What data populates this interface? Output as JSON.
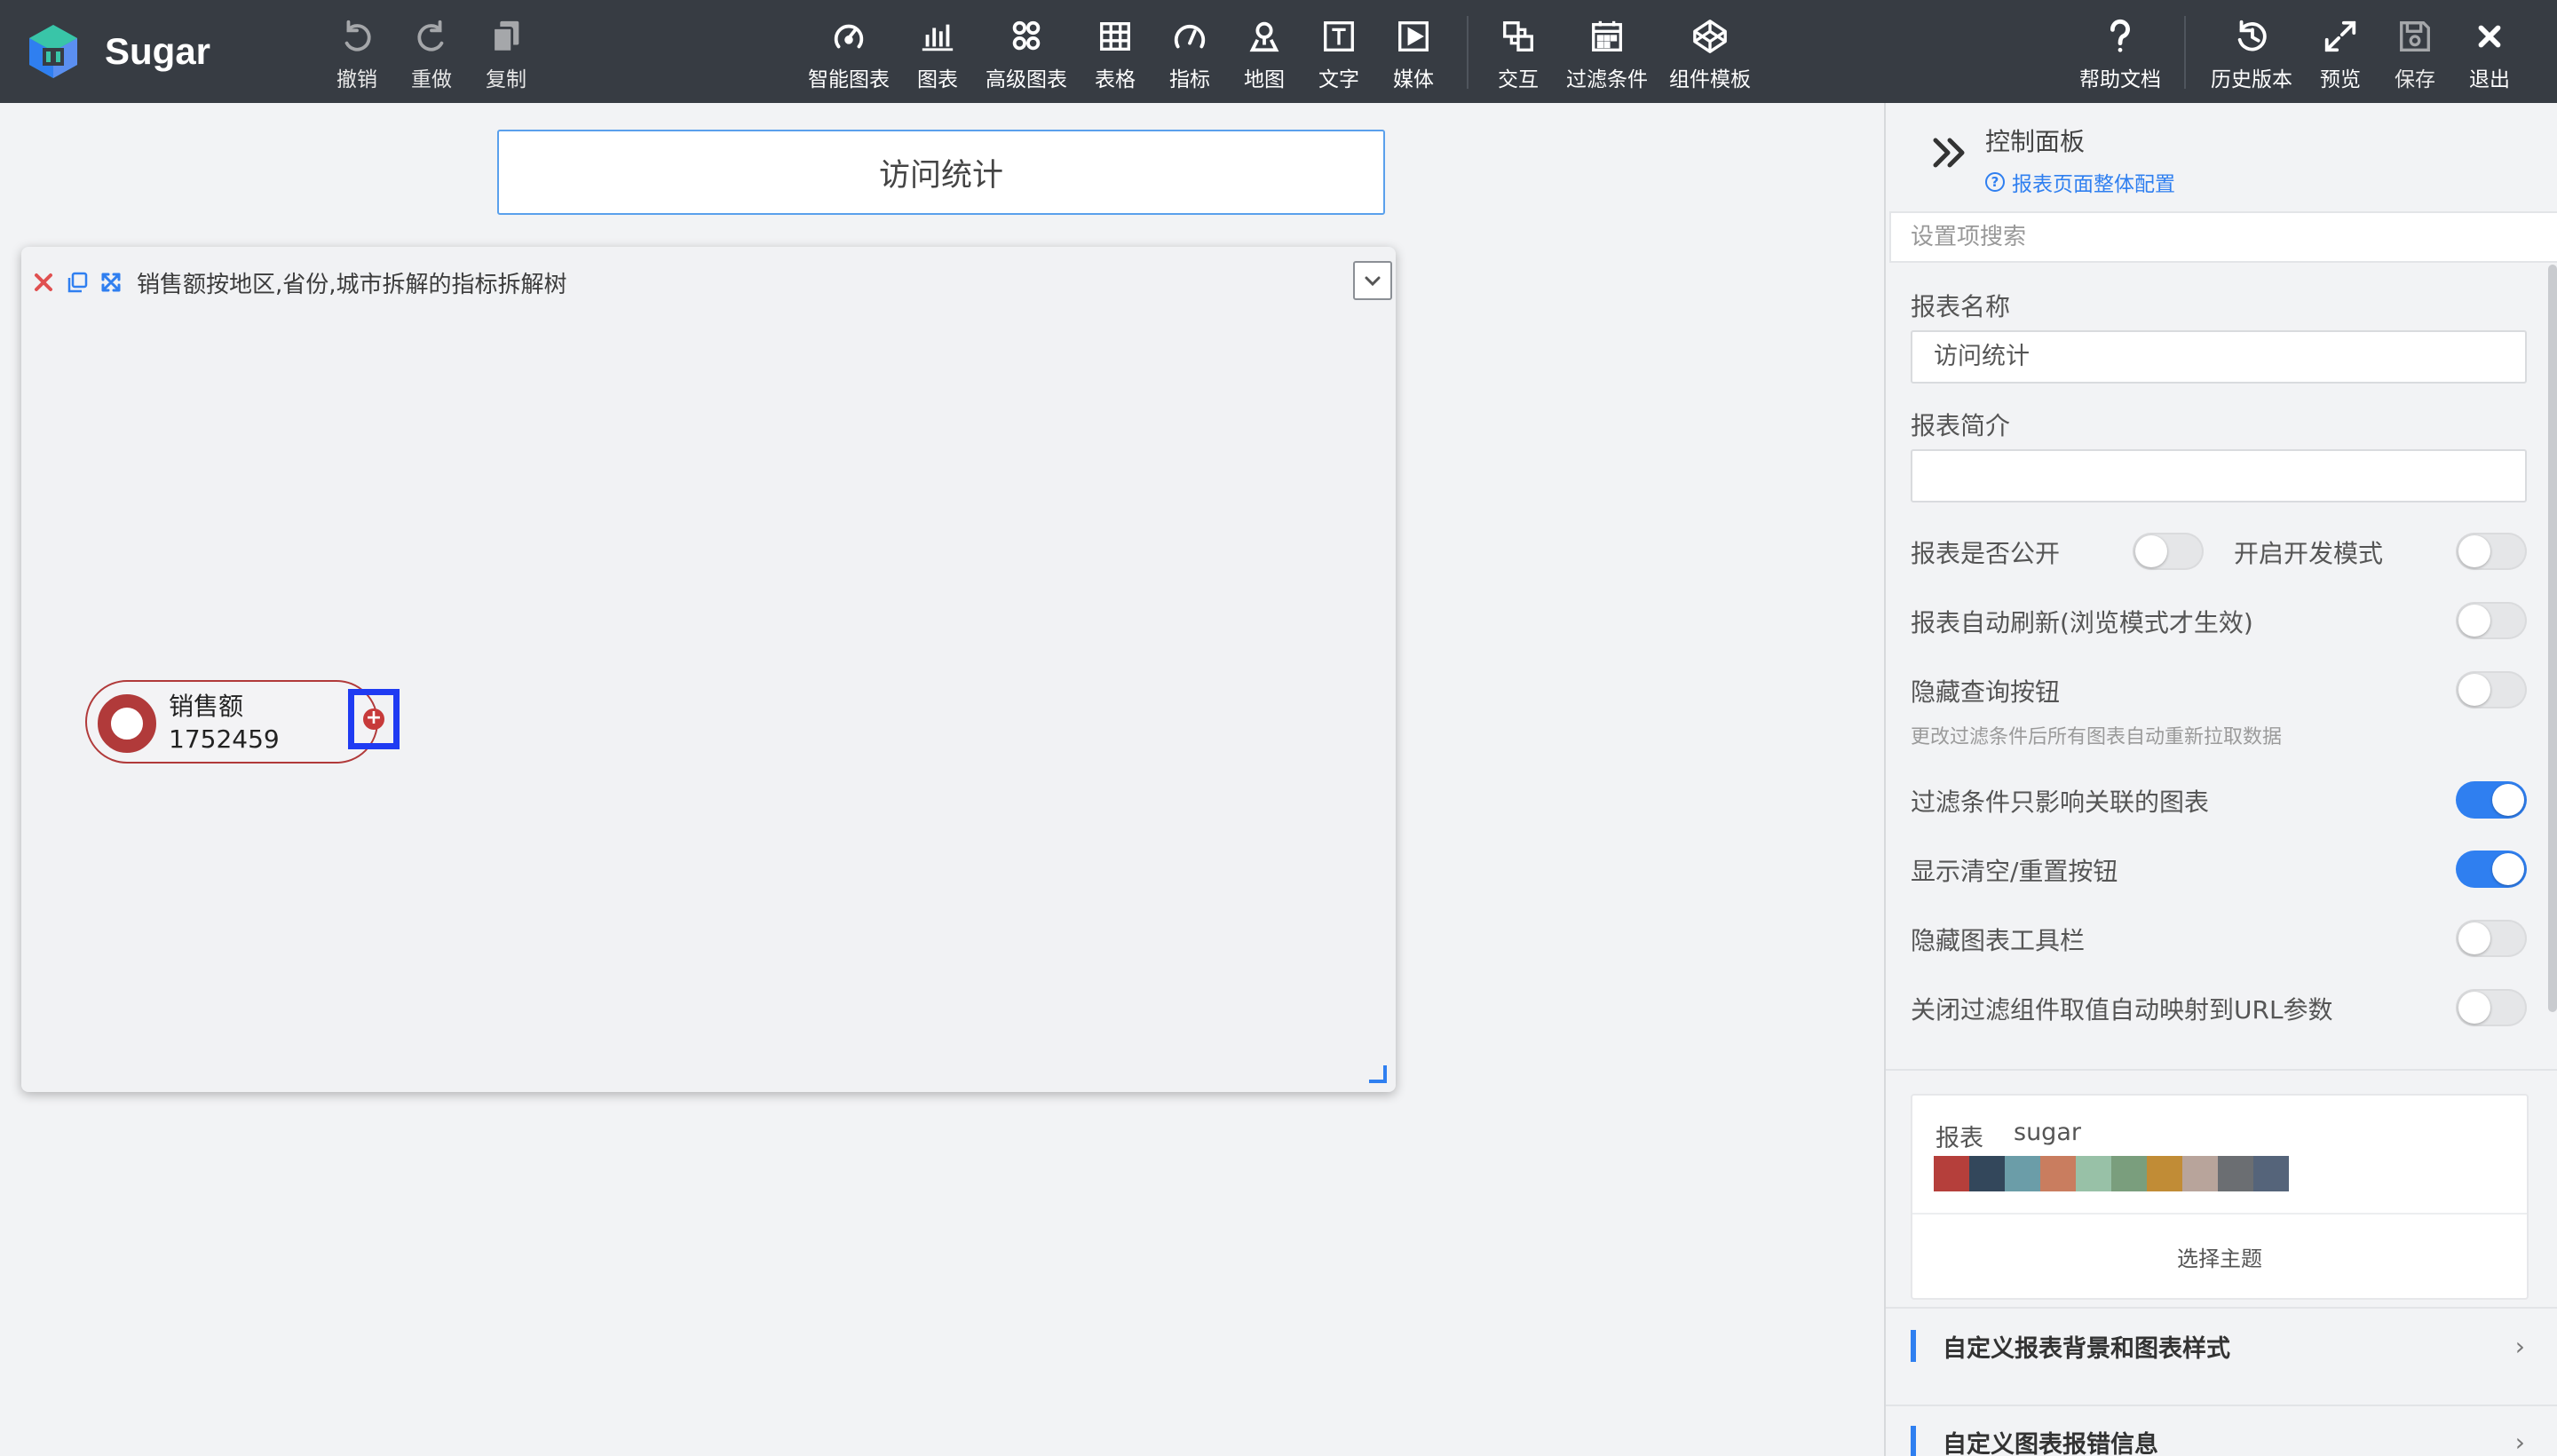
{
  "brand": {
    "name": "Sugar"
  },
  "toolbar": {
    "left": [
      {
        "id": "undo",
        "label": "撤销",
        "icon": "undo-icon"
      },
      {
        "id": "redo",
        "label": "重做",
        "icon": "redo-icon"
      },
      {
        "id": "copy",
        "label": "复制",
        "icon": "copy-icon"
      }
    ],
    "center": [
      {
        "id": "smart-chart",
        "label": "智能图表",
        "icon": "smart-chart-icon"
      },
      {
        "id": "chart",
        "label": "图表",
        "icon": "bar-chart-icon"
      },
      {
        "id": "adv-chart",
        "label": "高级图表",
        "icon": "advanced-chart-icon"
      },
      {
        "id": "table",
        "label": "表格",
        "icon": "table-icon"
      },
      {
        "id": "metric",
        "label": "指标",
        "icon": "gauge-icon"
      },
      {
        "id": "map",
        "label": "地图",
        "icon": "map-pin-icon"
      },
      {
        "id": "text",
        "label": "文字",
        "icon": "text-icon"
      },
      {
        "id": "media",
        "label": "媒体",
        "icon": "media-icon"
      },
      {
        "id": "interaction",
        "label": "交互",
        "icon": "interaction-icon"
      },
      {
        "id": "filter",
        "label": "过滤条件",
        "icon": "filter-calendar-icon"
      },
      {
        "id": "templates",
        "label": "组件模板",
        "icon": "codepen-icon"
      }
    ],
    "right": [
      {
        "id": "help",
        "label": "帮助文档",
        "icon": "question-icon"
      },
      {
        "id": "history",
        "label": "历史版本",
        "icon": "history-icon"
      },
      {
        "id": "preview",
        "label": "预览",
        "icon": "expand-icon"
      },
      {
        "id": "save",
        "label": "保存",
        "icon": "save-icon"
      },
      {
        "id": "exit",
        "label": "退出",
        "icon": "close-icon"
      }
    ]
  },
  "canvas": {
    "report_title": "访问统计",
    "card": {
      "title": "销售额按地区,省份,城市拆解的指标拆解树",
      "node": {
        "label": "销售额",
        "value": "1752459"
      }
    }
  },
  "panel": {
    "title": "控制面板",
    "config_link": "报表页面整体配置",
    "search_placeholder": "设置项搜索",
    "report_name_label": "报表名称",
    "report_name_value": "访问统计",
    "report_desc_label": "报表简介",
    "report_desc_value": "",
    "public_label": "报表是否公开",
    "public_on": false,
    "dev_mode_label": "开启开发模式",
    "dev_mode_on": false,
    "auto_refresh_label": "报表自动刷新(浏览模式才生效)",
    "auto_refresh_on": false,
    "hide_query_label": "隐藏查询按钮",
    "hide_query_hint": "更改过滤条件后所有图表自动重新拉取数据",
    "hide_query_on": false,
    "filter_related_label": "过滤条件只影响关联的图表",
    "filter_related_on": true,
    "show_reset_label": "显示清空/重置按钮",
    "show_reset_on": true,
    "hide_toolbar_label": "隐藏图表工具栏",
    "hide_toolbar_on": false,
    "close_url_label": "关闭过滤组件取值自动映射到URL参数",
    "close_url_on": false,
    "theme": {
      "prefix": "报表",
      "name": "sugar",
      "colors": [
        "#b53f3b",
        "#33475b",
        "#6b9da8",
        "#c97d5f",
        "#98c1a7",
        "#7a9e7d",
        "#c18c36",
        "#b8a49b",
        "#6b6e72",
        "#55647a"
      ],
      "select_label": "选择主题"
    },
    "sections": [
      {
        "label": "自定义报表背景和图表样式"
      },
      {
        "label": "自定义图表报错信息"
      }
    ]
  }
}
